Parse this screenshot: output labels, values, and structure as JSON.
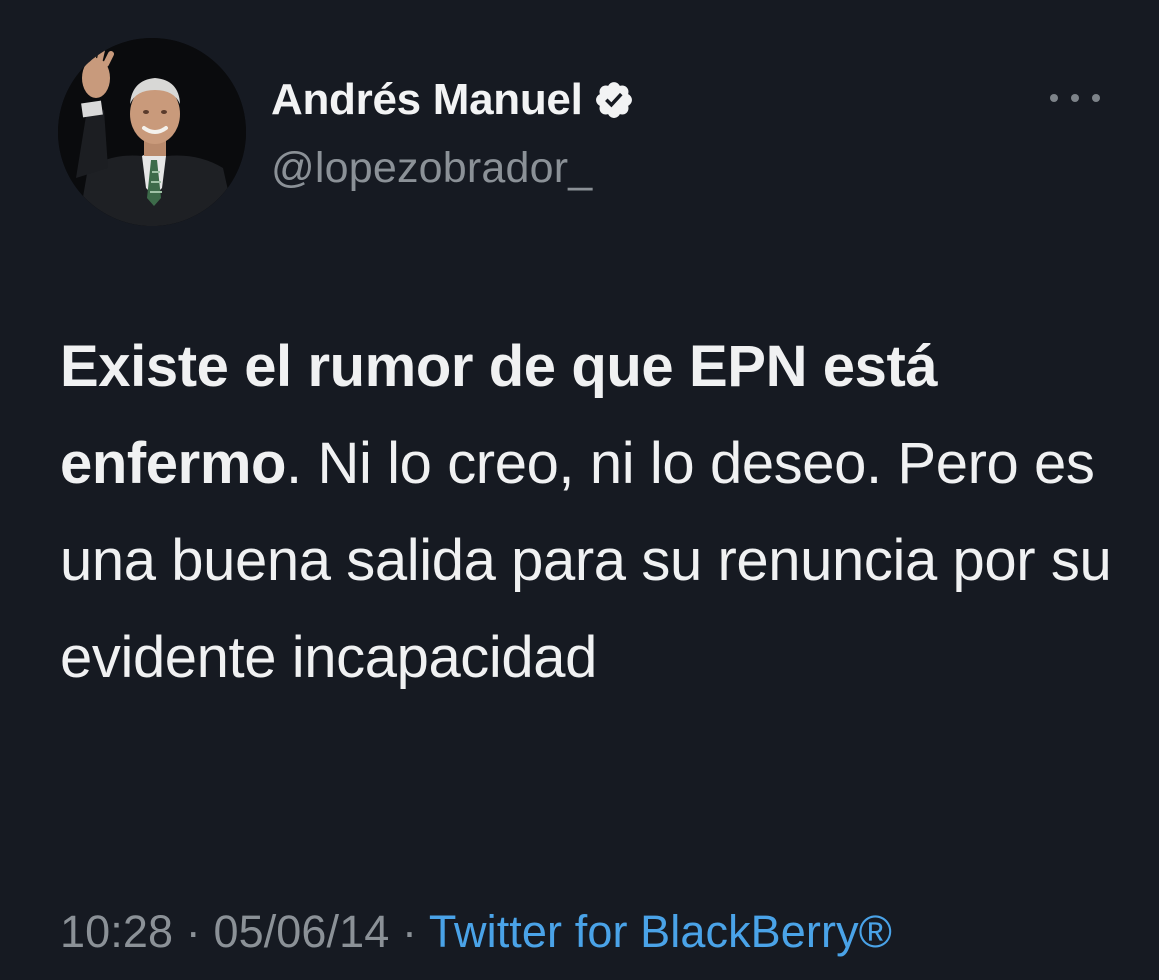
{
  "tweet": {
    "author": {
      "name": "Andrés Manuel",
      "handle": "@lopezobrador_",
      "verified": true
    },
    "text": {
      "bold_part": "Existe el rumor de que EPN está enfermo",
      "regular_part": ". Ni lo creo, ni lo deseo. Pero es una buena salida para su renuncia por su evidente incapacidad"
    },
    "meta": {
      "time": "10:28",
      "separator": "·",
      "date": "05/06/14",
      "source": "Twitter for BlackBerry®"
    }
  },
  "icons": {
    "verified": "verified-badge-icon",
    "more": "more-options-icon"
  },
  "colors": {
    "background": "#161a22",
    "primary_text": "#f0f1f2",
    "secondary_text": "#8b9197",
    "link": "#4aa3e8"
  }
}
